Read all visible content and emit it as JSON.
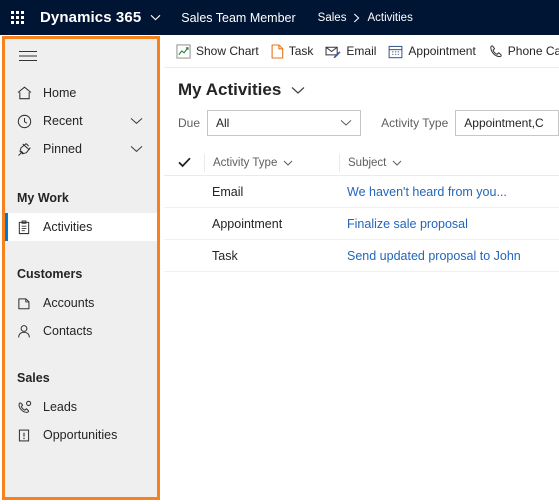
{
  "header": {
    "waffle_icon": "app-launcher-icon",
    "brand": "Dynamics 365",
    "brand_chevron_icon": "chevron-down-icon",
    "app_name": "Sales Team Member",
    "breadcrumb": {
      "root": "Sales",
      "separator_icon": "chevron-right-icon",
      "current": "Activities"
    },
    "background_color": "#001433"
  },
  "sidebar": {
    "highlight_color": "#F7821B",
    "background_color": "#EFEFEF",
    "selected_indicator_color": "#0078D4",
    "hamburger_icon": "hamburger-menu-icon",
    "top_items": [
      {
        "label": "Home",
        "icon": "home-icon",
        "expandable": false
      },
      {
        "label": "Recent",
        "icon": "clock-icon",
        "expandable": true
      },
      {
        "label": "Pinned",
        "icon": "pin-icon",
        "expandable": true
      }
    ],
    "groups": [
      {
        "title": "My Work",
        "items": [
          {
            "label": "Activities",
            "icon": "clipboard-icon",
            "selected": true
          }
        ]
      },
      {
        "title": "Customers",
        "items": [
          {
            "label": "Accounts",
            "icon": "building-icon",
            "selected": false
          },
          {
            "label": "Contacts",
            "icon": "person-icon",
            "selected": false
          }
        ]
      },
      {
        "title": "Sales",
        "items": [
          {
            "label": "Leads",
            "icon": "lead-phone-icon",
            "selected": false
          },
          {
            "label": "Opportunities",
            "icon": "opportunity-icon",
            "selected": false
          }
        ]
      }
    ]
  },
  "commandbar": {
    "buttons": [
      {
        "label": "Show Chart",
        "icon": "chart-icon",
        "color": "#2E8540"
      },
      {
        "label": "Task",
        "icon": "task-page-icon",
        "color": "#E8761B"
      },
      {
        "label": "Email",
        "icon": "email-edit-icon",
        "color": "#2B579A"
      },
      {
        "label": "Appointment",
        "icon": "calendar-icon",
        "color": "#3A5A8C"
      },
      {
        "label": "Phone Call",
        "icon": "phone-icon",
        "color": "#3A3A3A"
      }
    ]
  },
  "view": {
    "title": "My Activities",
    "title_chevron_icon": "chevron-down-icon"
  },
  "filters": [
    {
      "label": "Due",
      "value": "All",
      "chevron_icon": "chevron-down-icon",
      "name": "due-filter"
    },
    {
      "label": "Activity Type",
      "value": "Appointment,C",
      "chevron_icon": "chevron-down-icon",
      "name": "activity-type-filter"
    }
  ],
  "grid": {
    "select_all_icon": "checkmark-icon",
    "columns": [
      {
        "label": "Activity Type",
        "sort_icon": "chevron-down-icon"
      },
      {
        "label": "Subject",
        "sort_icon": "chevron-down-icon"
      }
    ],
    "rows": [
      {
        "activity_type": "Email",
        "subject": "We haven't heard from you..."
      },
      {
        "activity_type": "Appointment",
        "subject": "Finalize sale proposal"
      },
      {
        "activity_type": "Task",
        "subject": "Send updated proposal to John"
      }
    ],
    "link_color": "#2266BB"
  }
}
